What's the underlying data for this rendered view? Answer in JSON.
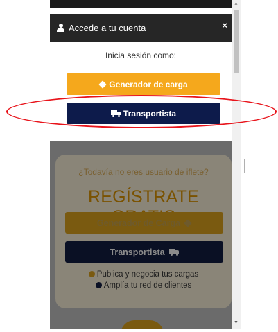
{
  "modal": {
    "title": "Accede a tu cuenta",
    "close_label": "×",
    "prompt": "Inicia sesión como:",
    "btn_generador": "Generador de carga",
    "btn_transportista": "Transportista"
  },
  "page": {
    "question": "¿Todavía no eres usuario de iflete?",
    "register": "REGÍSTRATE GRATIS",
    "btn_generador": "Generador de Carga",
    "btn_transportista": "Transportista",
    "benefits": [
      "Publica y negocia tus cargas",
      "Amplía tu red de clientes"
    ]
  },
  "icons": {
    "user": "user-icon",
    "close": "close-icon",
    "cube": "cube-icon",
    "truck": "truck-icon",
    "check": "check-circle-icon"
  },
  "colors": {
    "accent_orange": "#f5a81c",
    "accent_navy": "#0d1b4b",
    "header_dark": "#262626",
    "annotation_red": "#e8141b"
  }
}
